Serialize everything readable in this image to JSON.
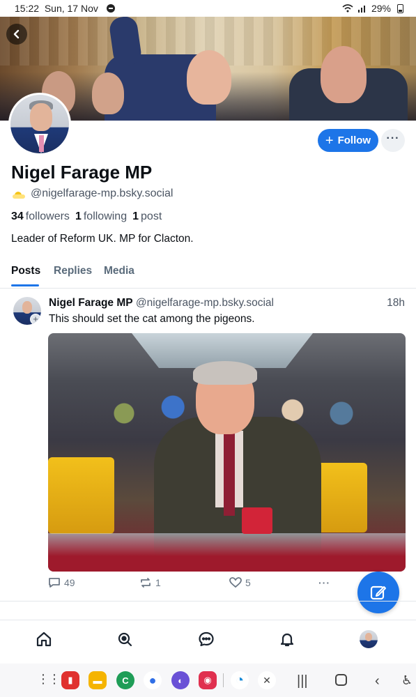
{
  "status_bar": {
    "time": "15:22",
    "date": "Sun, 17 Nov",
    "battery": "29%"
  },
  "profile": {
    "display_name": "Nigel Farage MP",
    "handle": "@nigelfarage-mp.bsky.social",
    "followers_count": "34",
    "followers_label": "followers",
    "following_count": "1",
    "following_label": "following",
    "posts_count": "1",
    "posts_label": "post",
    "bio": "Leader of Reform UK. MP for Clacton.",
    "follow_label": "Follow",
    "more_label": "···"
  },
  "tabs": [
    {
      "label": "Posts",
      "active": true
    },
    {
      "label": "Replies",
      "active": false
    },
    {
      "label": "Media",
      "active": false
    }
  ],
  "post": {
    "author_name": "Nigel Farage MP",
    "author_handle": "@nigelfarage-mp.bsky.social",
    "time": "18h",
    "text": "This should set the cat among the pigeons.",
    "replies": "49",
    "reposts": "1",
    "likes": "5",
    "more_label": "···"
  },
  "colors": {
    "accent": "#1d75e8",
    "text": "#0b0f14",
    "muted": "#4b5563"
  },
  "icons": {
    "back": "chevron-left-icon",
    "compose": "compose-icon",
    "nav": [
      "home-icon",
      "search-icon",
      "chat-icon",
      "bell-icon",
      "profile-avatar"
    ]
  }
}
